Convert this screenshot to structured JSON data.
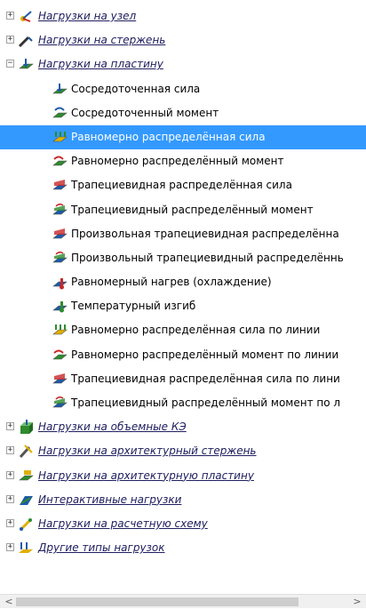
{
  "tree": {
    "groups_top": [
      {
        "label": "Нагрузки на узел",
        "expander": "+",
        "icon": "node-loads-icon"
      },
      {
        "label": "Нагрузки на стержень",
        "expander": "+",
        "icon": "bar-loads-icon"
      },
      {
        "label": "Нагрузки на пластину",
        "expander": "−",
        "icon": "plate-loads-icon"
      }
    ],
    "plate_items": [
      {
        "label": "Сосредоточенная сила",
        "icon": "concentrated-force-icon"
      },
      {
        "label": "Сосредоточенный момент",
        "icon": "concentrated-moment-icon"
      },
      {
        "label": "Равномерно распределённая сила",
        "icon": "uniform-force-icon",
        "selected": true
      },
      {
        "label": "Равномерно распределённый момент",
        "icon": "uniform-moment-icon"
      },
      {
        "label": "Трапециевидная распределённая сила",
        "icon": "trapezoidal-force-icon"
      },
      {
        "label": "Трапециевидный распределённый момент",
        "icon": "trapezoidal-moment-icon"
      },
      {
        "label": "Произвольная трапециевидная распределённа",
        "icon": "arbitrary-trapezoidal-force-icon"
      },
      {
        "label": "Произвольный трапециевидный распределённь",
        "icon": "arbitrary-trapezoidal-moment-icon"
      },
      {
        "label": "Равномерный нагрев (охлаждение)",
        "icon": "uniform-heating-icon"
      },
      {
        "label": "Температурный изгиб",
        "icon": "temperature-bending-icon"
      },
      {
        "label": "Равномерно распределённая сила по линии",
        "icon": "line-uniform-force-icon"
      },
      {
        "label": "Равномерно распределённый момент по линии",
        "icon": "line-uniform-moment-icon"
      },
      {
        "label": "Трапециевидная распределённая сила по лини",
        "icon": "line-trapezoidal-force-icon"
      },
      {
        "label": "Трапециевидный распределённый момент по л",
        "icon": "line-trapezoidal-moment-icon"
      }
    ],
    "groups_bottom": [
      {
        "label": "Нагрузки на объемные КЭ",
        "expander": "+",
        "icon": "solid-fe-loads-icon"
      },
      {
        "label": "Нагрузки на архитектурный стержень",
        "expander": "+",
        "icon": "arch-bar-loads-icon"
      },
      {
        "label": "Нагрузки на архитектурную пластину",
        "expander": "+",
        "icon": "arch-plate-loads-icon"
      },
      {
        "label": "Интерактивные нагрузки",
        "expander": "+",
        "icon": "interactive-loads-icon"
      },
      {
        "label": "Нагрузки на расчетную схему",
        "expander": "+",
        "icon": "design-scheme-loads-icon"
      },
      {
        "label": "Другие типы нагрузок",
        "expander": "+",
        "icon": "other-loads-icon"
      }
    ]
  },
  "scrollbar": {
    "left_arrow": "<",
    "right_arrow": ">"
  },
  "colors": {
    "selection": "#3399ff",
    "green": "#2e8b2e",
    "blue": "#1e5aa8",
    "red": "#c82828",
    "yellow": "#e0b000"
  }
}
